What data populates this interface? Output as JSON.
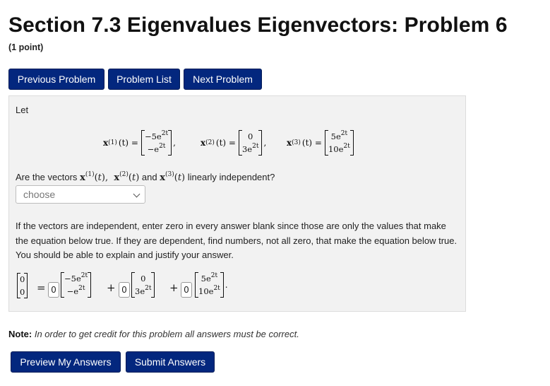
{
  "page": {
    "title": "Section 7.3 Eigenvalues Eigenvectors: Problem 6",
    "points": "(1 point)"
  },
  "nav": {
    "previous": "Previous Problem",
    "list": "Problem List",
    "next": "Next Problem"
  },
  "problem": {
    "let": "Let",
    "vectors": [
      {
        "label": "x",
        "sup": "(1)",
        "arg": "(t) =",
        "entries": [
          [
            "−5e",
            "2t"
          ],
          [
            "−e",
            "2t"
          ]
        ],
        "sep": ","
      },
      {
        "label": "x",
        "sup": "(2)",
        "arg": "(t) =",
        "entries": [
          [
            "0",
            ""
          ],
          [
            "3e",
            "2t"
          ]
        ],
        "sep": ","
      },
      {
        "label": "x",
        "sup": "(3)",
        "arg": "(t) =",
        "entries": [
          [
            "5e",
            "2t"
          ],
          [
            "10e",
            "2t"
          ]
        ],
        "sep": ""
      }
    ],
    "question_prefix": "Are the vectors",
    "question_and": "and",
    "question_suffix": "linearly independent?",
    "select_value": "choose",
    "instructions": "If the vectors are independent, enter zero in every answer blank since those are only the values that make the equation below true. If they are dependent, find numbers, not all zero, that make the equation below true. You should be able to explain and justify your answer.",
    "answers": [
      "0",
      "0",
      "0"
    ]
  },
  "note": {
    "label": "Note:",
    "text": "In order to get credit for this problem all answers must be correct."
  },
  "actions": {
    "preview": "Preview My Answers",
    "submit": "Submit Answers"
  }
}
